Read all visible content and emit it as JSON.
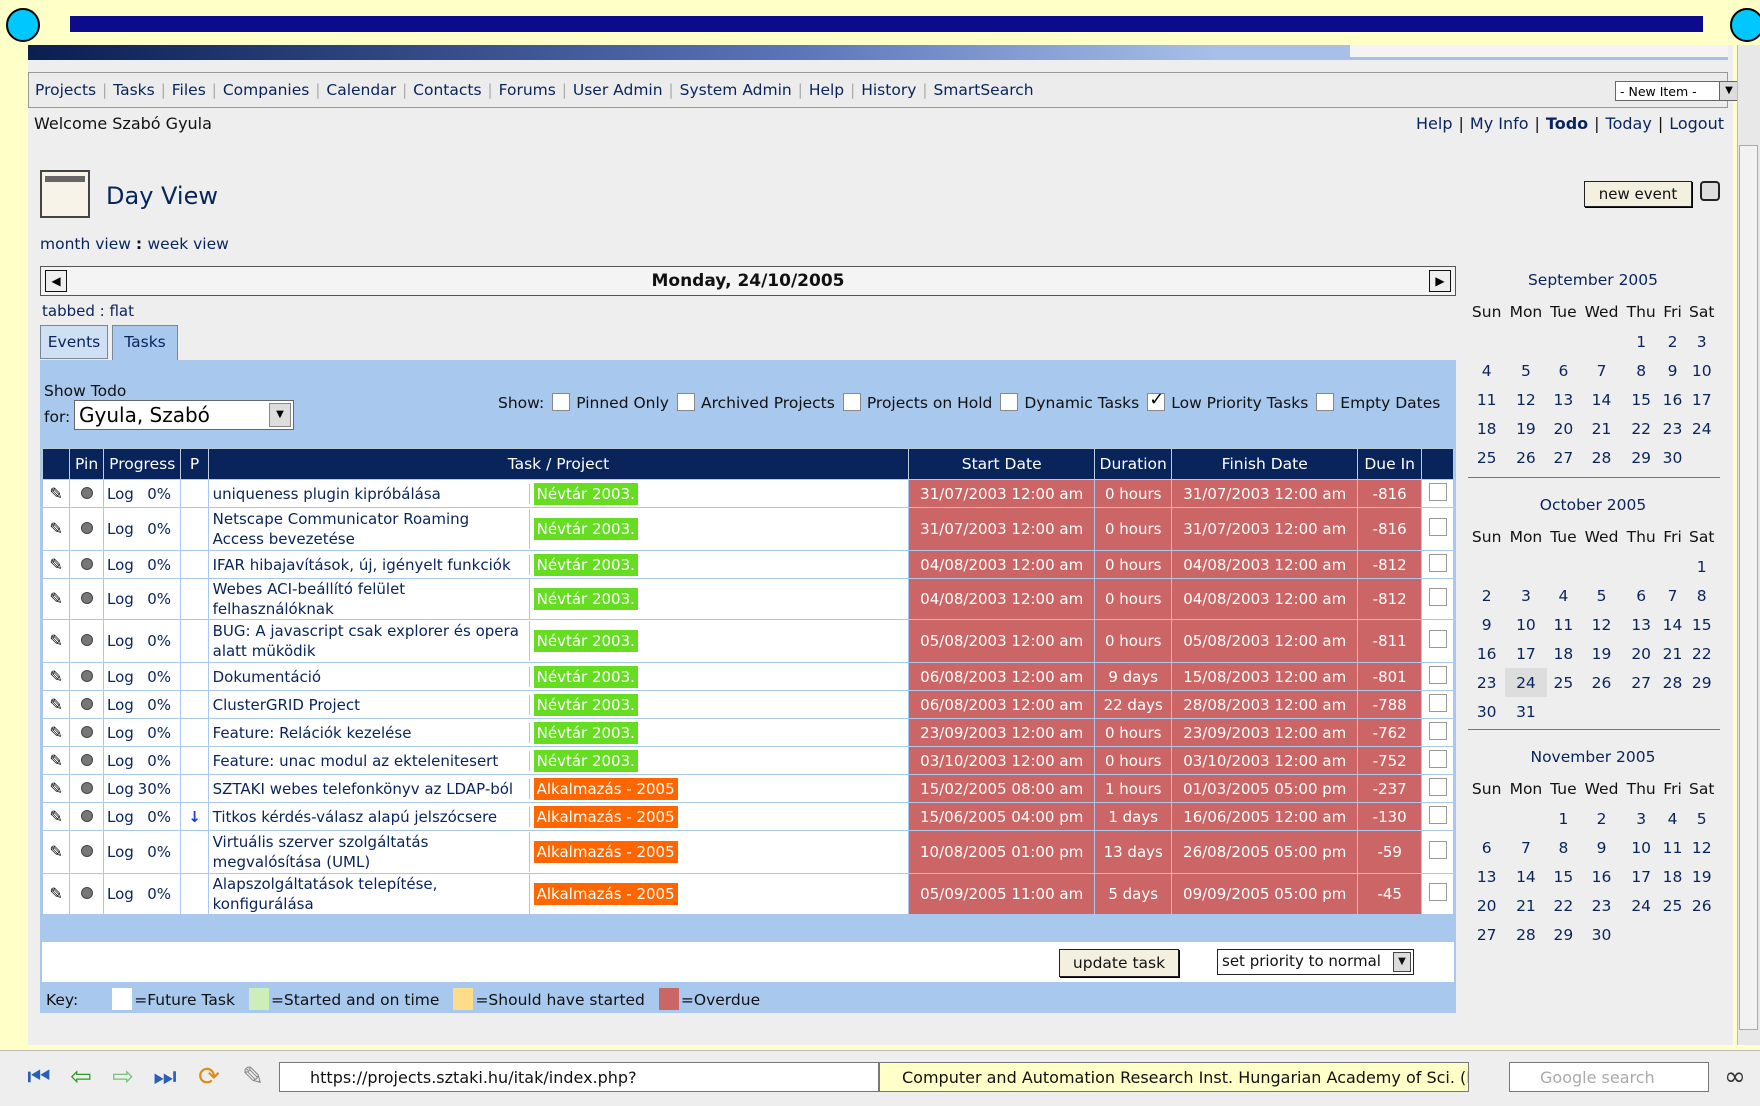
{
  "nav": {
    "links": [
      "Projects",
      "Tasks",
      "Files",
      "Companies",
      "Calendar",
      "Contacts",
      "Forums",
      "User Admin",
      "System Admin",
      "Help",
      "History",
      "SmartSearch"
    ],
    "new_item": "- New Item -"
  },
  "header": {
    "welcome": "Welcome Szabó Gyula",
    "links": [
      "Help",
      "My Info",
      "Todo",
      "Today",
      "Logout"
    ]
  },
  "page": {
    "title": "Day View",
    "new_event": "new event",
    "month_view": "month view",
    "week_view": "week view",
    "date": "Monday, 24/10/2005",
    "tabbed": "tabbed",
    "flat": "flat",
    "tabs": [
      "Events",
      "Tasks"
    ]
  },
  "filters": {
    "show_todo": "Show Todo",
    "for": "for:",
    "user": "Gyula, Szabó",
    "show": "Show:",
    "options": [
      {
        "label": "Pinned Only",
        "checked": false
      },
      {
        "label": "Archived Projects",
        "checked": false
      },
      {
        "label": "Projects on Hold",
        "checked": false
      },
      {
        "label": "Dynamic Tasks",
        "checked": false
      },
      {
        "label": "Low Priority Tasks",
        "checked": true
      },
      {
        "label": "Empty Dates",
        "checked": false
      }
    ]
  },
  "table": {
    "headers": [
      "",
      "Pin",
      "Progress",
      "P",
      "Task / Project",
      "Start Date",
      "Duration",
      "Finish Date",
      "Due In",
      ""
    ],
    "rows": [
      {
        "log": "Log",
        "progress": "0%",
        "prio": "",
        "task": "uniqueness plugin kipróbálása",
        "project": "Névtár 2003.",
        "pcolor": "#66dd22",
        "start": "31/07/2003 12:00 am",
        "duration": "0 hours",
        "finish": "31/07/2003 12:00 am",
        "due": "-816"
      },
      {
        "log": "Log",
        "progress": "0%",
        "prio": "",
        "task": "Netscape Communicator Roaming Access bevezetése",
        "project": "Névtár 2003.",
        "pcolor": "#66dd22",
        "start": "31/07/2003 12:00 am",
        "duration": "0 hours",
        "finish": "31/07/2003 12:00 am",
        "due": "-816"
      },
      {
        "log": "Log",
        "progress": "0%",
        "prio": "",
        "task": "IFAR hibajavítások, új, igényelt funkciók",
        "project": "Névtár 2003.",
        "pcolor": "#66dd22",
        "start": "04/08/2003 12:00 am",
        "duration": "0 hours",
        "finish": "04/08/2003 12:00 am",
        "due": "-812"
      },
      {
        "log": "Log",
        "progress": "0%",
        "prio": "",
        "task": "Webes ACI-beállító felület felhasználóknak",
        "project": "Névtár 2003.",
        "pcolor": "#66dd22",
        "start": "04/08/2003 12:00 am",
        "duration": "0 hours",
        "finish": "04/08/2003 12:00 am",
        "due": "-812"
      },
      {
        "log": "Log",
        "progress": "0%",
        "prio": "",
        "task": "BUG: A javascript csak explorer és opera alatt müködik",
        "project": "Névtár 2003.",
        "pcolor": "#66dd22",
        "start": "05/08/2003 12:00 am",
        "duration": "0 hours",
        "finish": "05/08/2003 12:00 am",
        "due": "-811"
      },
      {
        "log": "Log",
        "progress": "0%",
        "prio": "",
        "task": "Dokumentáció",
        "project": "Névtár 2003.",
        "pcolor": "#66dd22",
        "start": "06/08/2003 12:00 am",
        "duration": "9 days",
        "finish": "15/08/2003 12:00 am",
        "due": "-801"
      },
      {
        "log": "Log",
        "progress": "0%",
        "prio": "",
        "task": "ClusterGRID Project",
        "project": "Névtár 2003.",
        "pcolor": "#66dd22",
        "start": "06/08/2003 12:00 am",
        "duration": "22 days",
        "finish": "28/08/2003 12:00 am",
        "due": "-788"
      },
      {
        "log": "Log",
        "progress": "0%",
        "prio": "",
        "task": "Feature: Relációk kezelése",
        "project": "Névtár 2003.",
        "pcolor": "#66dd22",
        "start": "23/09/2003 12:00 am",
        "duration": "0 hours",
        "finish": "23/09/2003 12:00 am",
        "due": "-762"
      },
      {
        "log": "Log",
        "progress": "0%",
        "prio": "",
        "task": "Feature: unac modul az ektelenitesert",
        "project": "Névtár 2003.",
        "pcolor": "#66dd22",
        "start": "03/10/2003 12:00 am",
        "duration": "0 hours",
        "finish": "03/10/2003 12:00 am",
        "due": "-752"
      },
      {
        "log": "Log",
        "progress": "30%",
        "prio": "",
        "task": "SZTAKI webes telefonkönyv az LDAP-ból",
        "project": "Alkalmazás - 2005",
        "pcolor": "#ff6600",
        "start": "15/02/2005 08:00 am",
        "duration": "1 hours",
        "finish": "01/03/2005 05:00 pm",
        "due": "-237"
      },
      {
        "log": "Log",
        "progress": "0%",
        "prio": "↓",
        "task": "Titkos kérdés-válasz alapú jelszócsere",
        "project": "Alkalmazás - 2005",
        "pcolor": "#ff6600",
        "start": "15/06/2005 04:00 pm",
        "duration": "1 days",
        "finish": "16/06/2005 12:00 am",
        "due": "-130"
      },
      {
        "log": "Log",
        "progress": "0%",
        "prio": "",
        "task": "Virtuális szerver szolgáltatás megvalósítása (UML)",
        "project": "Alkalmazás - 2005",
        "pcolor": "#ff6600",
        "start": "10/08/2005 01:00 pm",
        "duration": "13 days",
        "finish": "26/08/2005 05:00 pm",
        "due": "-59"
      },
      {
        "log": "Log",
        "progress": "0%",
        "prio": "",
        "task": "Alapszolgáltatások telepítése, konfigurálása",
        "project": "Alkalmazás - 2005",
        "pcolor": "#ff6600",
        "start": "05/09/2005 11:00 am",
        "duration": "5 days",
        "finish": "09/09/2005 05:00 pm",
        "due": "-45"
      }
    ],
    "update_task": "update task",
    "priority_select": "set priority to normal"
  },
  "key": {
    "label": "Key:",
    "items": [
      {
        "label": "=Future Task",
        "color": "#ffffff"
      },
      {
        "label": "=Started and on time",
        "color": "#cceebb"
      },
      {
        "label": "=Should have started",
        "color": "#ffdd88"
      },
      {
        "label": "=Overdue",
        "color": "#cc6666"
      }
    ]
  },
  "calendars": [
    {
      "title": "September 2005",
      "days": [
        "Sun",
        "Mon",
        "Tue",
        "Wed",
        "Thu",
        "Fri",
        "Sat"
      ],
      "weeks": [
        [
          "",
          "",
          "",
          "",
          "1",
          "2",
          "3"
        ],
        [
          "4",
          "5",
          "6",
          "7",
          "8",
          "9",
          "10"
        ],
        [
          "11",
          "12",
          "13",
          "14",
          "15",
          "16",
          "17"
        ],
        [
          "18",
          "19",
          "20",
          "21",
          "22",
          "23",
          "24"
        ],
        [
          "25",
          "26",
          "27",
          "28",
          "29",
          "30",
          ""
        ]
      ]
    },
    {
      "title": "October 2005",
      "days": [
        "Sun",
        "Mon",
        "Tue",
        "Wed",
        "Thu",
        "Fri",
        "Sat"
      ],
      "weeks": [
        [
          "",
          "",
          "",
          "",
          "",
          "",
          "1"
        ],
        [
          "2",
          "3",
          "4",
          "5",
          "6",
          "7",
          "8"
        ],
        [
          "9",
          "10",
          "11",
          "12",
          "13",
          "14",
          "15"
        ],
        [
          "16",
          "17",
          "18",
          "19",
          "20",
          "21",
          "22"
        ],
        [
          "23",
          "24",
          "25",
          "26",
          "27",
          "28",
          "29"
        ],
        [
          "30",
          "31",
          "",
          "",
          "",
          "",
          ""
        ]
      ]
    },
    {
      "title": "November 2005",
      "days": [
        "Sun",
        "Mon",
        "Tue",
        "Wed",
        "Thu",
        "Fri",
        "Sat"
      ],
      "weeks": [
        [
          "",
          "",
          "1",
          "2",
          "3",
          "4",
          "5"
        ],
        [
          "6",
          "7",
          "8",
          "9",
          "10",
          "11",
          "12"
        ],
        [
          "13",
          "14",
          "15",
          "16",
          "17",
          "18",
          "19"
        ],
        [
          "20",
          "21",
          "22",
          "23",
          "24",
          "25",
          "26"
        ],
        [
          "27",
          "28",
          "29",
          "30",
          "",
          "",
          ""
        ]
      ]
    }
  ],
  "today": "24",
  "browser": {
    "url": "https://projects.sztaki.hu/itak/index.php?",
    "site": "Computer and Automation Research Inst. Hungarian Academy of Sci. (HU)",
    "search_placeholder": "Google search"
  }
}
